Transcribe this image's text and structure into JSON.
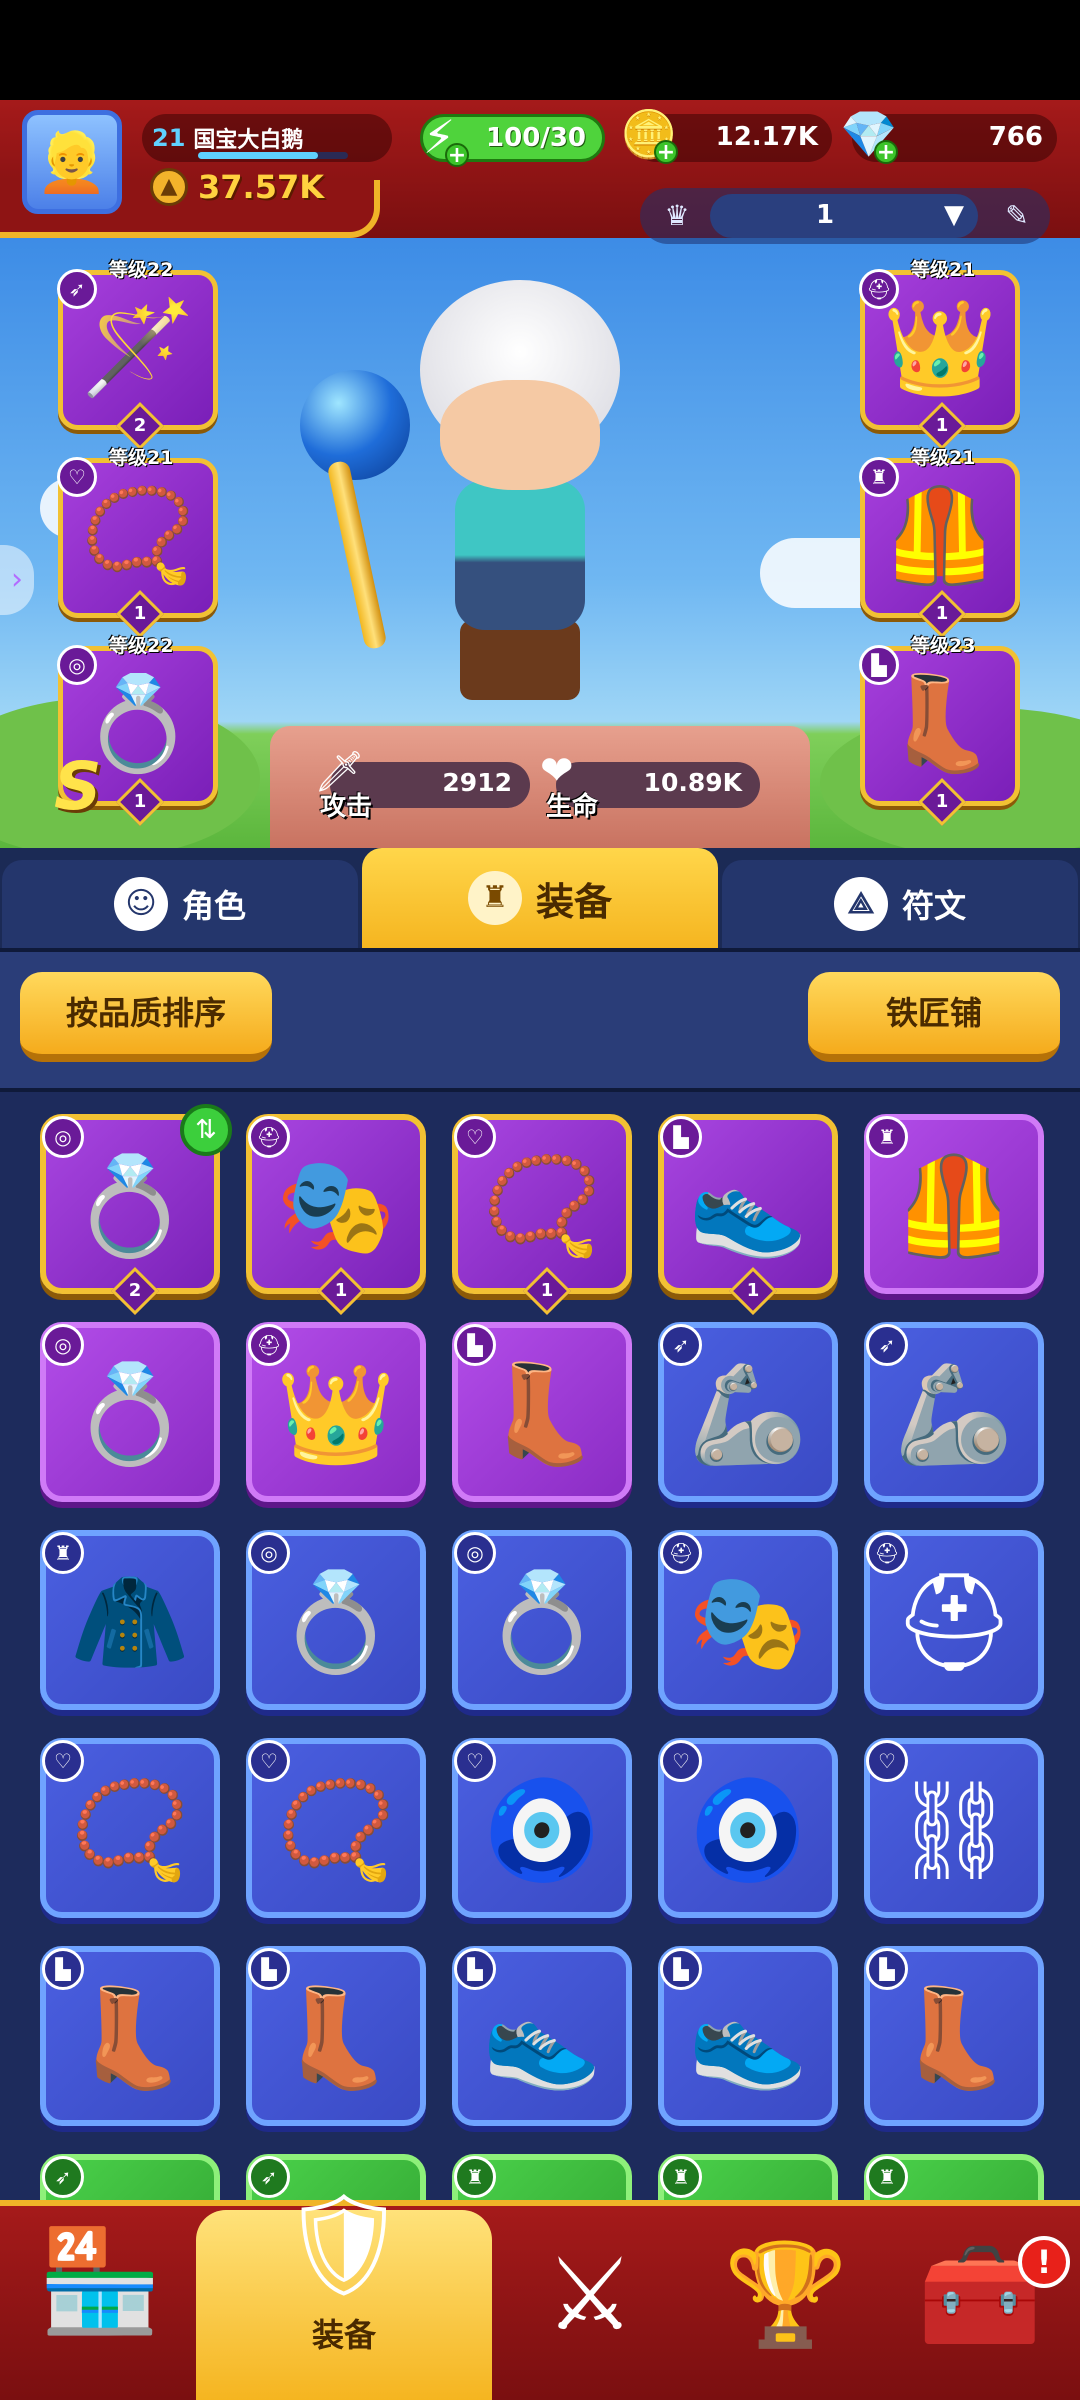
{
  "player": {
    "level": "21",
    "name": "国宝大白鹅",
    "xp_fraction": 0.8,
    "power": "37.57K"
  },
  "resources": {
    "energy": "100/30",
    "gold": "12.17K",
    "gems": "766"
  },
  "preset": {
    "value": "1"
  },
  "equipped_left": [
    {
      "level_label": "等级22",
      "icon": "magic-staff-icon",
      "glyph": "🪄",
      "stars": "2"
    },
    {
      "level_label": "等级21",
      "icon": "amulet-icon",
      "glyph": "📿",
      "stars": "1"
    },
    {
      "level_label": "等级22",
      "icon": "ring-icon",
      "glyph": "💍",
      "stars": "1"
    }
  ],
  "equipped_right": [
    {
      "level_label": "等级21",
      "icon": "crown-icon",
      "glyph": "👑",
      "stars": "1"
    },
    {
      "level_label": "等级21",
      "icon": "armor-icon",
      "glyph": "🦺",
      "stars": "1"
    },
    {
      "level_label": "等级23",
      "icon": "boot-icon",
      "glyph": "👢",
      "stars": "1"
    }
  ],
  "rank": "S",
  "stats": {
    "attack_label": "攻击",
    "attack_value": "2912",
    "hp_label": "生命",
    "hp_value": "10.89K"
  },
  "tabs": {
    "role": "角色",
    "equipment": "装备",
    "rune": "符文"
  },
  "buttons": {
    "sort": "按品质排序",
    "blacksmith": "铁匠铺"
  },
  "bottom_nav": {
    "equipment_label": "装备",
    "alert": "!"
  },
  "colors": {
    "header_red": "#a51a1a",
    "gold_border": "#f2c133",
    "epic_purple": "#8a2cc4",
    "rare_blue": "#3a4ac4",
    "uncommon_green": "#2f9e2f"
  }
}
